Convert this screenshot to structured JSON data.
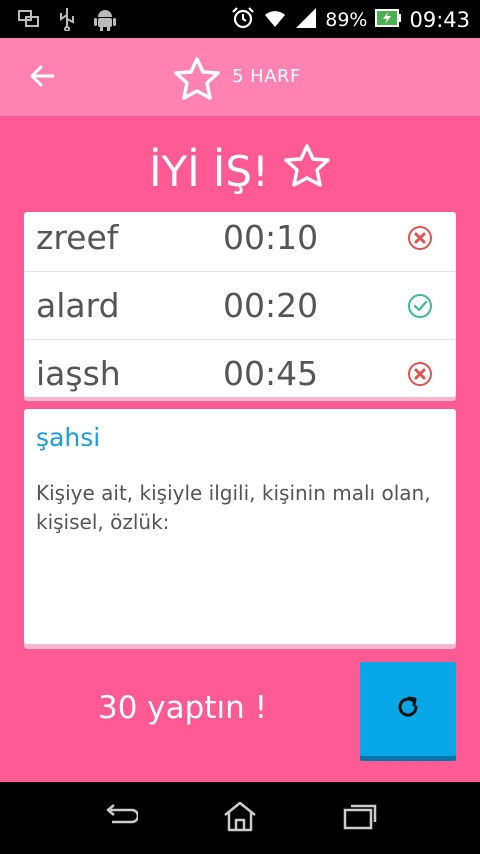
{
  "status_bar": {
    "battery": "89%",
    "time": "09:43",
    "icons": [
      "screen-icon",
      "usb-icon",
      "android-icon",
      "alarm-icon",
      "wifi-icon",
      "signal-icon",
      "battery-icon"
    ]
  },
  "app_bar": {
    "title": "5 HARF",
    "back_icon": "arrow-back-icon",
    "star_icon": "star-outline-icon"
  },
  "heading": {
    "text": "İYİ İŞ!",
    "star_icon": "star-outline-icon"
  },
  "results": [
    {
      "word": "zreef",
      "time": "00:10",
      "status": "wrong"
    },
    {
      "word": "alard",
      "time": "00:20",
      "status": "correct"
    },
    {
      "word": "iaşsh",
      "time": "00:45",
      "status": "wrong"
    }
  ],
  "definition": {
    "word": "şahsi",
    "text": "Kişiye ait, kişiyle ilgili, kişinin malı olan, kişisel, özlük:"
  },
  "score_text": "30 yaptın !",
  "refresh_icon": "refresh-icon",
  "nav_bar": {
    "icons": [
      "back-icon",
      "home-icon",
      "recents-icon"
    ]
  },
  "colors": {
    "background": "#ff5a93",
    "app_bar": "#ff83b1",
    "accent_blue": "#08a8e8",
    "definition_word": "#1a9ddc",
    "correct": "#3cb98f",
    "wrong": "#e0524e"
  }
}
